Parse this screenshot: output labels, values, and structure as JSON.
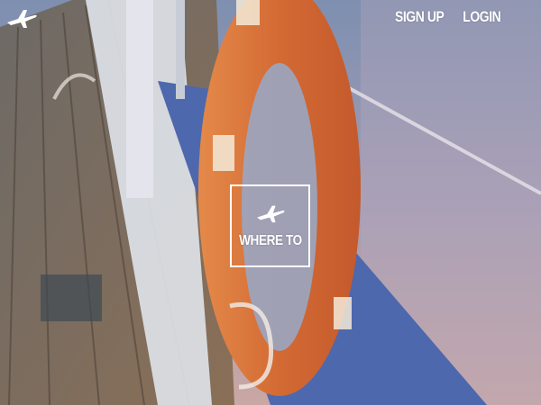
{
  "brand": {
    "logo_icon": "airplane-icon"
  },
  "nav": {
    "signup_label": "SIGN UP",
    "login_label": "LOGIN"
  },
  "cta": {
    "icon": "airplane-icon",
    "label": "WHERE TO"
  },
  "colors": {
    "text": "#ffffff",
    "sea": "#8a9cbc",
    "deck": "#7a6550",
    "lifebuoy": "#d9703a",
    "hull": "#4a64a8"
  }
}
